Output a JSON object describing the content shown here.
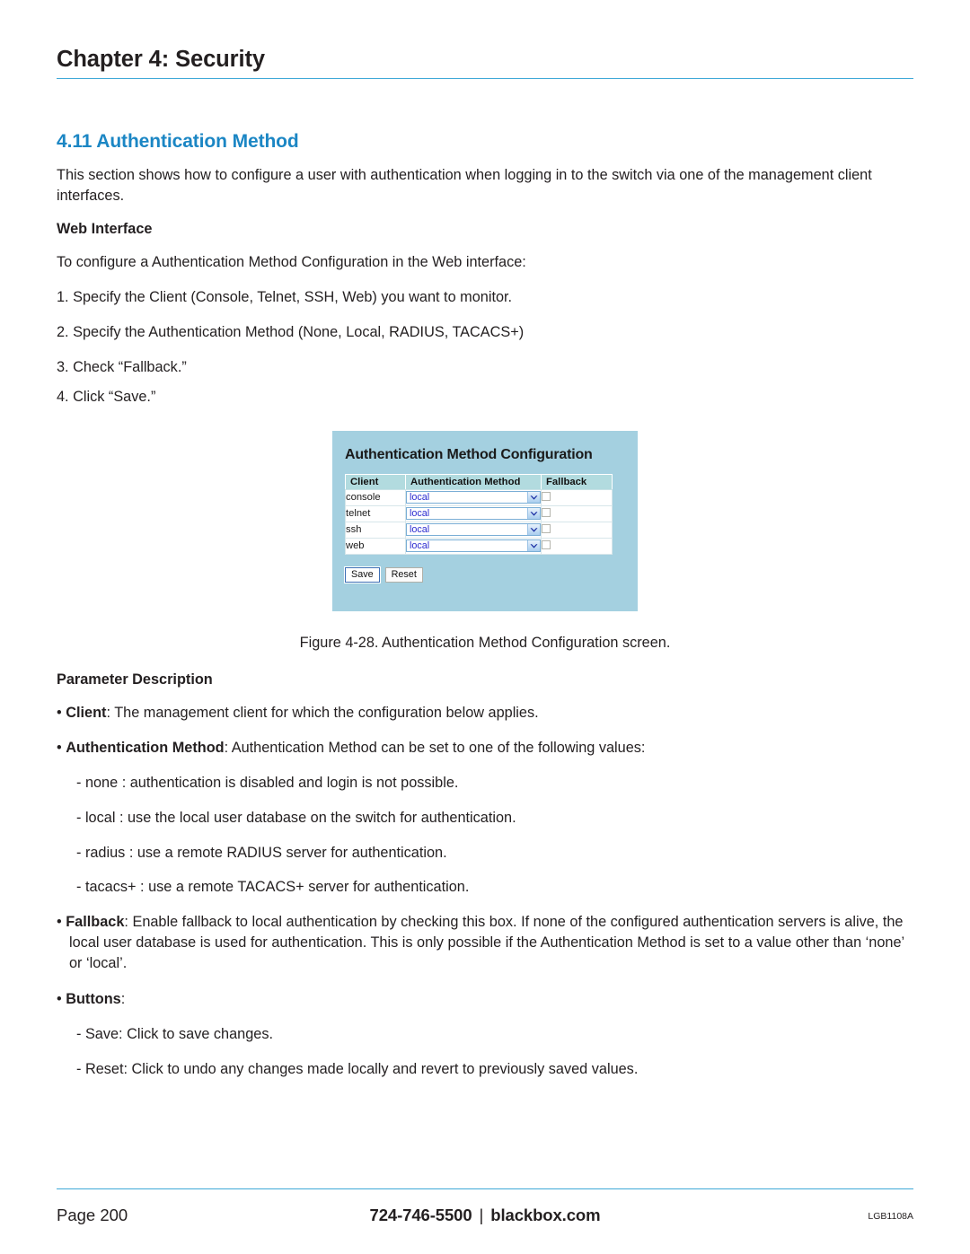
{
  "header": {
    "chapter_title": "Chapter 4: Security",
    "rule_color": "#3fa9d8"
  },
  "section": {
    "heading": "4.11 Authentication Method",
    "heading_color": "#1b86c4",
    "intro": "This section shows how to configure a user with authentication when logging in to the switch via one of the management client interfaces.",
    "subhead_web_interface": "Web Interface",
    "web_interface_lead": "To configure a Authentication Method Configuration in the Web interface:",
    "steps": [
      "1. Specify the Client (Console, Telnet, SSH, Web) you want to monitor.",
      "2. Specify the Authentication Method (None, Local, RADIUS, TACACS+)",
      "3. Check “Fallback.”",
      "4. Click “Save.”"
    ]
  },
  "figure": {
    "background_color": "#a4d0e0",
    "panel_title": "Authentication Method Configuration",
    "table": {
      "columns": [
        "Client",
        "Authentication Method",
        "Fallback"
      ],
      "rows": [
        {
          "client": "console",
          "method": "local",
          "fallback_checked": false
        },
        {
          "client": "telnet",
          "method": "local",
          "fallback_checked": false
        },
        {
          "client": "ssh",
          "method": "local",
          "fallback_checked": false
        },
        {
          "client": "web",
          "method": "local",
          "fallback_checked": false
        }
      ]
    },
    "buttons": {
      "save": "Save",
      "reset": "Reset"
    },
    "caption": "Figure 4-28. Authentication Method Configuration screen."
  },
  "parameters": {
    "heading": "Parameter Description",
    "client": {
      "term": "Client",
      "text": ": The management client for which the configuration below applies."
    },
    "auth_method": {
      "term": "Authentication Method",
      "text": ": Authentication Method can be set to one of the following values:",
      "values": [
        "- none : authentication is disabled and login is not possible.",
        "- local : use the local user database on the switch for authentication.",
        "- radius : use a remote RADIUS server for authentication.",
        "- tacacs+ : use a remote TACACS+ server for authentication."
      ]
    },
    "fallback": {
      "term": "Fallback",
      "text": ": Enable fallback to local authentication by checking this box. If none of the configured authentication servers is alive, the local user database is used for authentication. This is only possible if the Authentication Method is set to a value other than ‘none’ or ‘local’."
    },
    "buttons": {
      "term": "Buttons",
      "text": ":",
      "items": [
        "- Save: Click to save changes.",
        "- Reset: Click to undo any changes made locally and revert to previously saved values."
      ]
    }
  },
  "footer": {
    "page": "Page 200",
    "phone": "724-746-5500",
    "separator": "|",
    "website": "blackbox.com",
    "doc_code": "LGB1108A"
  }
}
